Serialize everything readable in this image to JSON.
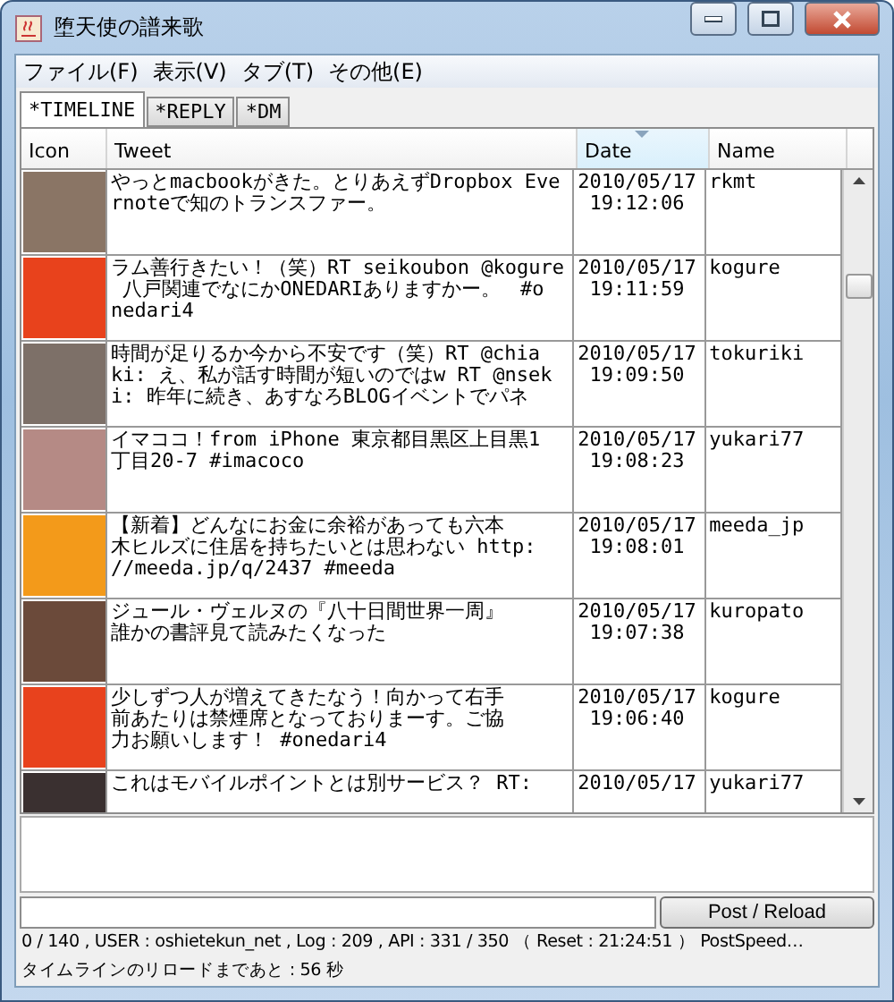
{
  "window": {
    "title": "堕天使の譜来歌"
  },
  "menu": [
    "ファイル(F)",
    "表示(V)",
    "タブ(T)",
    "その他(E)"
  ],
  "tabs": [
    {
      "label": "*TIMELINE",
      "selected": true
    },
    {
      "label": "*REPLY",
      "selected": false
    },
    {
      "label": "*DM",
      "selected": false
    }
  ],
  "table": {
    "columns": [
      {
        "label": "Icon",
        "sorted": false
      },
      {
        "label": "Tweet",
        "sorted": false
      },
      {
        "label": "Date",
        "sorted": true
      },
      {
        "label": "Name",
        "sorted": false
      }
    ],
    "rows": [
      {
        "avatar": {
          "color": "#8a7565"
        },
        "tweet": [
          "やっとmacbookがきた。とりあえずDropbox Eve",
          "rnoteで知のトランスファー。"
        ],
        "date": "2010/05/17",
        "time": "19:12:06",
        "name": "rkmt"
      },
      {
        "avatar": {
          "color": "#e8421c"
        },
        "tweet": [
          "ラム善行きたい！（笑）RT seikoubon @kogure",
          " 八戸関連でなにかONEDARIありますかー。　#o",
          "nedari4"
        ],
        "date": "2010/05/17",
        "time": "19:11:59",
        "name": "kogure"
      },
      {
        "avatar": {
          "color": "#7d7068"
        },
        "tweet": [
          "時間が足りるか今から不安です（笑）RT @chia",
          "ki: え、私が話す時間が短いのではw RT @nsek",
          "i: 昨年に続き、あすなろBLOGイベントでパネ"
        ],
        "date": "2010/05/17",
        "time": "19:09:50",
        "name": "tokuriki"
      },
      {
        "avatar": {
          "color": "#b58a85"
        },
        "tweet": [
          "イマココ！from iPhone 東京都目黒区上目黒1",
          "丁目20-7 #imacoco"
        ],
        "date": "2010/05/17",
        "time": "19:08:23",
        "name": "yukari77"
      },
      {
        "avatar": {
          "color": "#f39a1a"
        },
        "tweet": [
          "【新着】どんなにお金に余裕があっても六本",
          "木ヒルズに住居を持ちたいとは思わない http:",
          "//meeda.jp/q/2437 #meeda"
        ],
        "date": "2010/05/17",
        "time": "19:08:01",
        "name": "meeda_jp"
      },
      {
        "avatar": {
          "color": "#6b4a3a"
        },
        "tweet": [
          "ジュール・ヴェルヌの『八十日間世界一周』",
          "誰かの書評見て読みたくなった"
        ],
        "date": "2010/05/17",
        "time": "19:07:38",
        "name": "kuropato"
      },
      {
        "avatar": {
          "color": "#e8421d"
        },
        "tweet": [
          "少しずつ人が増えてきたなう！向かって右手",
          "前あたりは禁煙席となっておりまーす。ご協",
          "力お願いします！ #onedari4"
        ],
        "date": "2010/05/17",
        "time": "19:06:40",
        "name": "kogure"
      },
      {
        "avatar": {
          "color": "#3a3030"
        },
        "tweet": [
          "これはモバイルポイントとは別サービス？ RT:"
        ],
        "date": "2010/05/17",
        "name": "yukari77"
      }
    ]
  },
  "post_button": "Post / Reload",
  "status_bar": [
    "0 / 140 , USER : oshietekun_net , Log : 209 , API : 331 / 350 （ Reset : 21:24:51 ） PostSpeed…",
    "タイムラインのリロードまであと : 56 秒"
  ]
}
